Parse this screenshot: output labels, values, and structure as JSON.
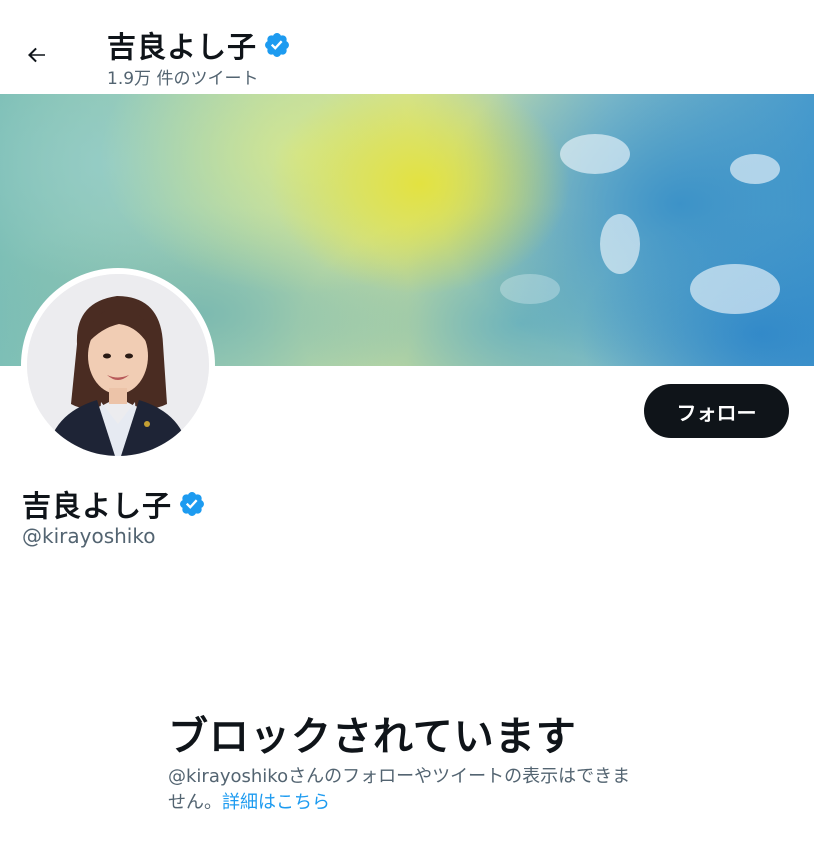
{
  "header": {
    "back_icon": "arrow-left-icon",
    "name": "吉良よし子",
    "verified_icon": "verified-badge-icon",
    "tweet_count": "1.9万 件のツイート"
  },
  "profile": {
    "name": "吉良よし子",
    "handle": "@kirayoshiko",
    "follow_label": "フォロー",
    "verified_color": "#1d9bf0"
  },
  "blocked": {
    "title": "ブロックされています",
    "description_prefix": "@kirayoshikoさんのフォローやツイートの表示はできません。",
    "learn_more": "詳細はこちら"
  },
  "colors": {
    "text_primary": "#0f1419",
    "text_secondary": "#536471",
    "accent": "#1d9bf0",
    "button_bg": "#0f1419"
  }
}
